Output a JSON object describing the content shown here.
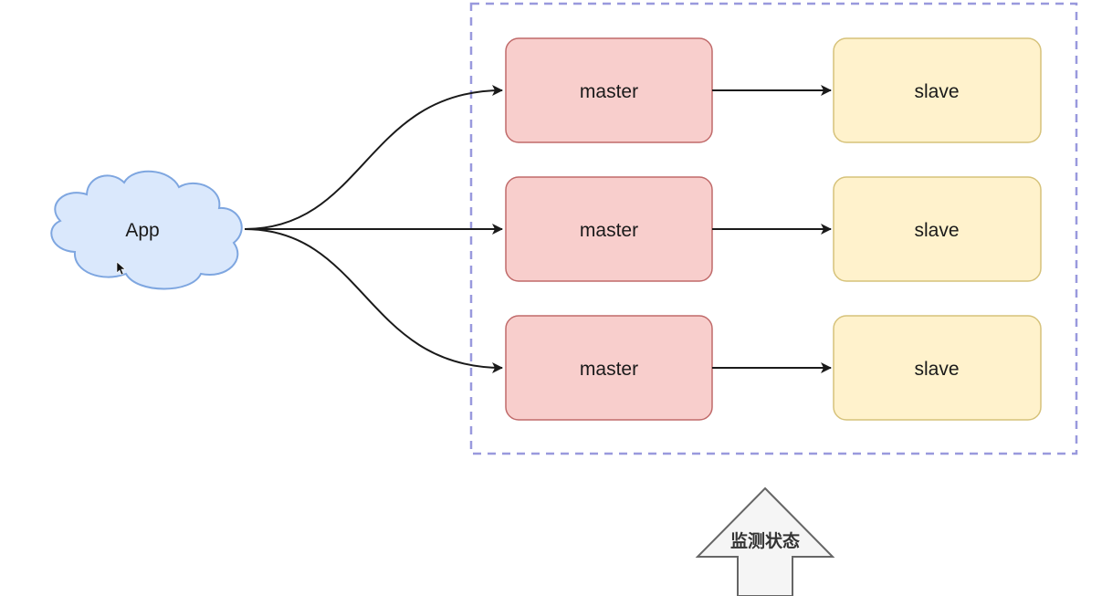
{
  "app": {
    "label": "App"
  },
  "cluster": {
    "rows": [
      {
        "master": "master",
        "slave": "slave"
      },
      {
        "master": "master",
        "slave": "slave"
      },
      {
        "master": "master",
        "slave": "slave"
      }
    ]
  },
  "monitor": {
    "label": "监测状态"
  },
  "colors": {
    "cloud_fill": "#dae8fc",
    "cloud_stroke": "#7ea6e0",
    "master_fill": "#f8cecc",
    "master_stroke": "#c06a6a",
    "slave_fill": "#fff2cc",
    "slave_stroke": "#d6c27a",
    "cluster_border": "#9999dd",
    "arrow": "#1a1a1a",
    "monitor_fill": "#f5f5f5",
    "monitor_stroke": "#666666"
  }
}
